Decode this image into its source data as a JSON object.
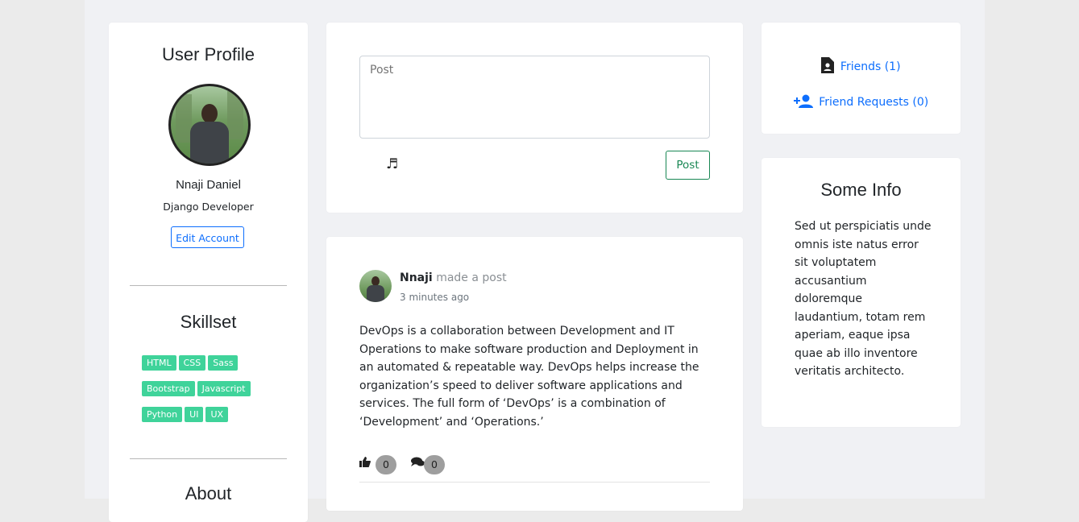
{
  "profile": {
    "title": "User Profile",
    "name": "Nnaji Daniel",
    "role": "Django Developer",
    "edit_label": "Edit Account",
    "skillset_title": "Skillset",
    "skills": [
      "HTML",
      "CSS",
      "Sass",
      "Bootstrap",
      "Javascript",
      "Python",
      "UI",
      "UX"
    ],
    "about_title": "About"
  },
  "composer": {
    "placeholder": "Post",
    "post_button": "Post",
    "music_icon": "music-note-icon"
  },
  "feed": {
    "post": {
      "author": "Nnaji",
      "action": "made a post",
      "time": "3 minutes ago",
      "body": "DevOps is a collaboration between Development and IT Operations to make software production and Deployment in an automated & repeatable way. DevOps helps increase the organization’s speed to deliver software applications and services. The full form of ‘DevOps’ is a combination of ‘Development’ and ‘Operations.’",
      "likes": "0",
      "comments": "0"
    }
  },
  "friends": {
    "friends_label": "Friends (1)",
    "requests_label": "Friend Requests (0)"
  },
  "info": {
    "title": "Some Info",
    "body": "Sed ut perspiciatis unde omnis iste natus error sit voluptatem accusantium doloremque laudantium, totam rem aperiam, eaque ipsa quae ab illo inventore veritatis architecto."
  },
  "colors": {
    "accent": "#0d6efd",
    "success": "#198754",
    "tag": "#3fd39a"
  }
}
